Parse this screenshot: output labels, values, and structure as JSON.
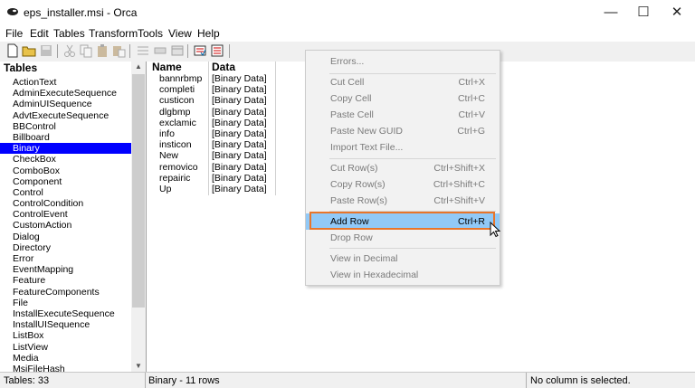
{
  "window": {
    "title": "eps_installer.msi - Orca",
    "minimize": "—",
    "maximize": "☐",
    "close": "✕"
  },
  "menu": [
    "File",
    "Edit",
    "Tables",
    "Transform",
    "Tools",
    "View",
    "Help"
  ],
  "tables_pane": {
    "header": "Tables",
    "items": [
      "ActionText",
      "AdminExecuteSequence",
      "AdminUISequence",
      "AdvtExecuteSequence",
      "BBControl",
      "Billboard",
      "Binary",
      "CheckBox",
      "ComboBox",
      "Component",
      "Control",
      "ControlCondition",
      "ControlEvent",
      "CustomAction",
      "Dialog",
      "Directory",
      "Error",
      "EventMapping",
      "Feature",
      "FeatureComponents",
      "File",
      "InstallExecuteSequence",
      "InstallUISequence",
      "ListBox",
      "ListView",
      "Media",
      "MsiFileHash"
    ],
    "selected": "Binary"
  },
  "data_pane": {
    "columns": [
      "Name",
      "Data"
    ],
    "rows": [
      [
        "bannrbmp",
        "[Binary Data]"
      ],
      [
        "completi",
        "[Binary Data]"
      ],
      [
        "custicon",
        "[Binary Data]"
      ],
      [
        "dlgbmp",
        "[Binary Data]"
      ],
      [
        "exclamic",
        "[Binary Data]"
      ],
      [
        "info",
        "[Binary Data]"
      ],
      [
        "insticon",
        "[Binary Data]"
      ],
      [
        "New",
        "[Binary Data]"
      ],
      [
        "removico",
        "[Binary Data]"
      ],
      [
        "repairic",
        "[Binary Data]"
      ],
      [
        "Up",
        "[Binary Data]"
      ]
    ]
  },
  "status": {
    "tables": "Tables: 33",
    "rows": "Binary - 11 rows",
    "column": "No column is selected."
  },
  "context_menu": {
    "errors": "Errors...",
    "cut_cell": "Cut Cell",
    "cut_cell_key": "Ctrl+X",
    "copy_cell": "Copy Cell",
    "copy_cell_key": "Ctrl+C",
    "paste_cell": "Paste Cell",
    "paste_cell_key": "Ctrl+V",
    "paste_guid": "Paste New GUID",
    "paste_guid_key": "Ctrl+G",
    "import_text": "Import Text File...",
    "cut_rows": "Cut Row(s)",
    "cut_rows_key": "Ctrl+Shift+X",
    "copy_rows": "Copy Row(s)",
    "copy_rows_key": "Ctrl+Shift+C",
    "paste_rows": "Paste Row(s)",
    "paste_rows_key": "Ctrl+Shift+V",
    "add_row": "Add Row",
    "add_row_key": "Ctrl+R",
    "drop_row": "Drop Row",
    "view_decimal": "View in Decimal",
    "view_hex": "View in Hexadecimal"
  },
  "colors": {
    "selection": "#0000ff",
    "menu_highlight": "#91c9f7",
    "callout": "#e8752a"
  }
}
